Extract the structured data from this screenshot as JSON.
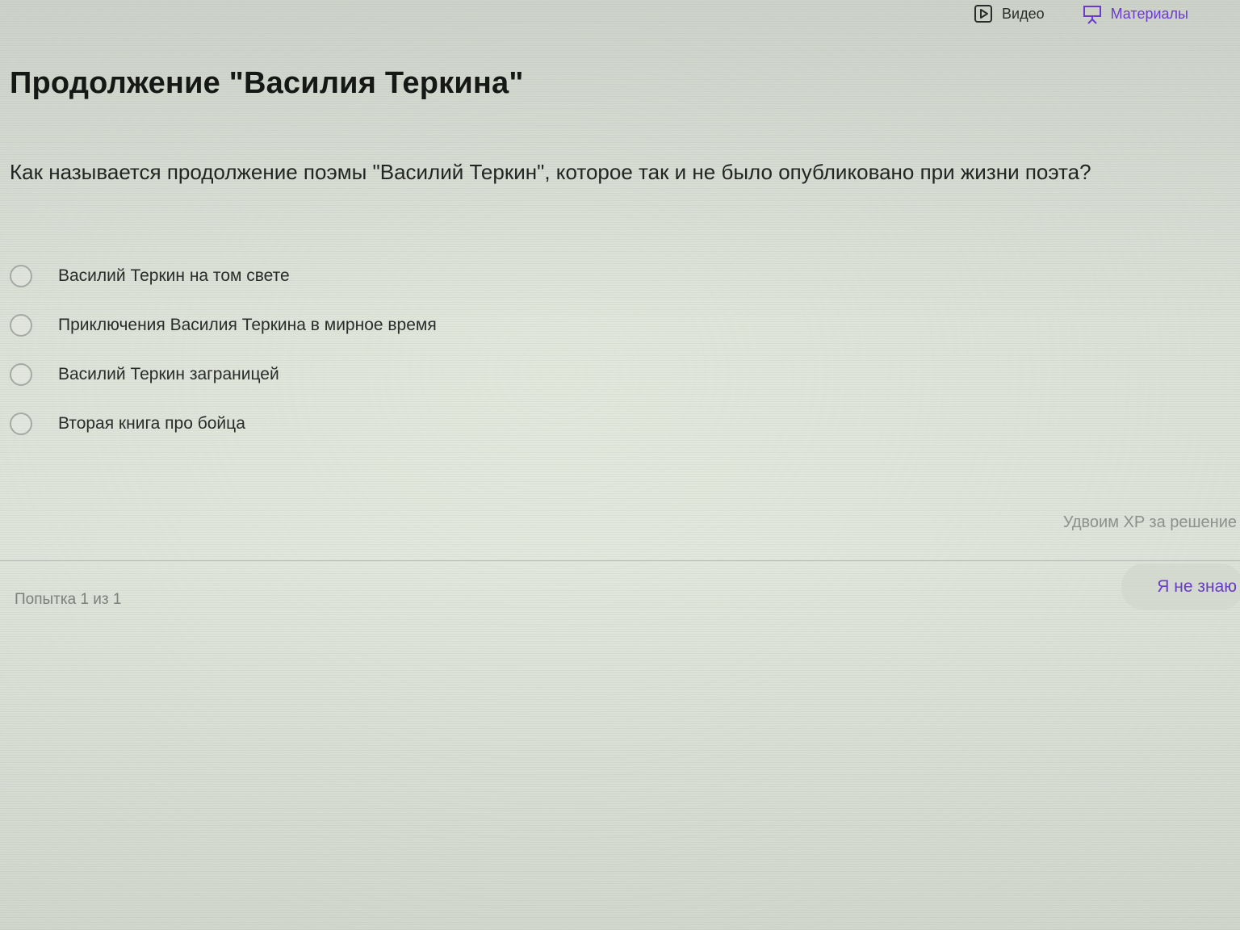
{
  "header": {
    "video_label": "Видео",
    "materials_label": "Материалы",
    "video_icon": "play-square-icon",
    "materials_icon": "presentation-board-icon"
  },
  "page": {
    "title": "Продолжение \"Василия Теркина\""
  },
  "quiz": {
    "question": "Как называется продолжение поэмы \"Василий Теркин\", которое так и не было опубликовано при жизни поэта?",
    "options": [
      {
        "label": "Василий Теркин на том свете",
        "selected": false
      },
      {
        "label": "Приключения Василия Теркина в мирное время",
        "selected": false
      },
      {
        "label": "Василий Теркин заграницей",
        "selected": false
      },
      {
        "label": "Вторая книга про бойца",
        "selected": false
      }
    ]
  },
  "footer": {
    "xp_note": "Удвоим XP за решение",
    "attempts": "Попытка 1 из 1",
    "dont_know_label": "Я не знаю"
  },
  "colors": {
    "accent": "#6a3cc7",
    "text": "#1f2220",
    "muted": "#8d918c"
  }
}
